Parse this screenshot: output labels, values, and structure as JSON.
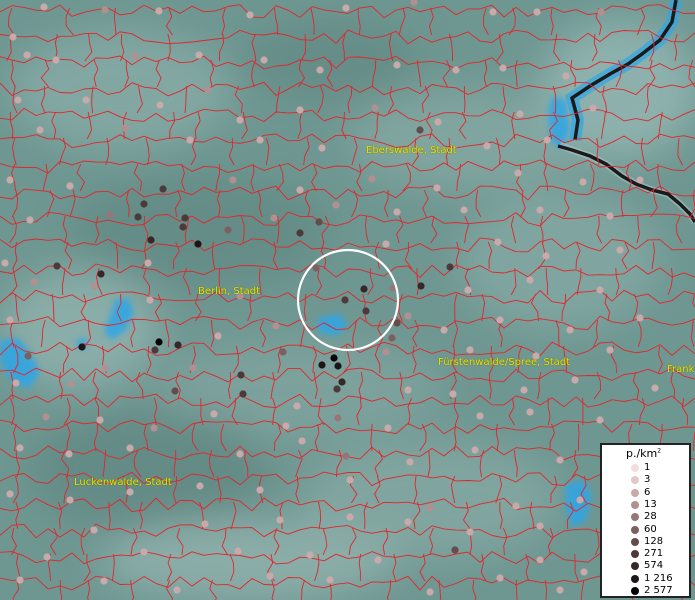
{
  "cities": [
    {
      "name": "Eberswalde, Stadt"
    },
    {
      "name": "Berlin, Stadt"
    },
    {
      "name": "Fürstenwalde/Spree, Stadt"
    },
    {
      "name": "Frank"
    },
    {
      "name": "Luckenwalde, Stadt"
    }
  ],
  "legend": {
    "title": "p./km",
    "title_sup": "2",
    "entries": [
      {
        "label": "1",
        "color": "#f3dede"
      },
      {
        "label": "3",
        "color": "#e2c8c8"
      },
      {
        "label": "6",
        "color": "#c9aaaa"
      },
      {
        "label": "13",
        "color": "#b09090"
      },
      {
        "label": "28",
        "color": "#967777"
      },
      {
        "label": "60",
        "color": "#7c6060"
      },
      {
        "label": "128",
        "color": "#634c4c"
      },
      {
        "label": "271",
        "color": "#4c3a3a"
      },
      {
        "label": "574",
        "color": "#342828"
      },
      {
        "label": "1 216",
        "color": "#1e1616"
      },
      {
        "label": "2 577",
        "color": "#050303"
      }
    ]
  },
  "colors": {
    "background": "#6f9792",
    "boundaries": "#e0262b",
    "water": "#2fa6e6",
    "border": "#1a1a1a",
    "label": "#e8e400"
  }
}
